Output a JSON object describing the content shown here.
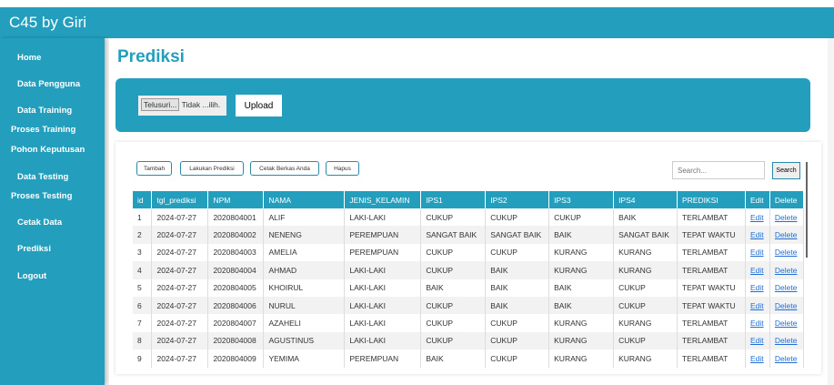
{
  "app_title": "C45 by Giri",
  "sidebar": {
    "items": [
      {
        "label": "Home"
      },
      {
        "label": "Data Pengguna"
      },
      {
        "label": "Data Training"
      },
      {
        "label": "Proses Training"
      },
      {
        "label": "Pohon Keputusan"
      },
      {
        "label": "Data Testing"
      },
      {
        "label": "Proses Testing"
      },
      {
        "label": "Cetak Data"
      },
      {
        "label": "Prediksi"
      },
      {
        "label": "Logout"
      }
    ]
  },
  "page_title": "Prediksi",
  "upload": {
    "browse": "Telusuri...",
    "file_status": "Tidak ...ilih.",
    "upload_label": "Upload"
  },
  "toolbar": {
    "tambah": "Tambah",
    "lakukan": "Lakukan Prediksi",
    "cetak": "Cetak Berkas Anda",
    "hapus": "Hapus",
    "search_placeholder": "Search...",
    "search_label": "Search"
  },
  "table": {
    "headers": [
      "id",
      "tgl_prediksi",
      "NPM",
      "NAMA",
      "JENIS_KELAMIN",
      "IPS1",
      "IPS2",
      "IPS3",
      "IPS4",
      "PREDIKSI",
      "Edit",
      "Delete"
    ],
    "rows": [
      [
        "1",
        "2024-07-27",
        "2020804001",
        "ALIF",
        "LAKI-LAKI",
        "CUKUP",
        "CUKUP",
        "CUKUP",
        "BAIK",
        "TERLAMBAT",
        "Edit",
        "Delete"
      ],
      [
        "2",
        "2024-07-27",
        "2020804002",
        "NENENG",
        "PEREMPUAN",
        "SANGAT BAIK",
        "SANGAT BAIK",
        "BAIK",
        "SANGAT BAIK",
        "TEPAT WAKTU",
        "Edit",
        "Delete"
      ],
      [
        "3",
        "2024-07-27",
        "2020804003",
        "AMELIA",
        "PEREMPUAN",
        "CUKUP",
        "CUKUP",
        "KURANG",
        "KURANG",
        "TERLAMBAT",
        "Edit",
        "Delete"
      ],
      [
        "4",
        "2024-07-27",
        "2020804004",
        "AHMAD",
        "LAKI-LAKI",
        "CUKUP",
        "BAIK",
        "KURANG",
        "KURANG",
        "TERLAMBAT",
        "Edit",
        "Delete"
      ],
      [
        "5",
        "2024-07-27",
        "2020804005",
        "KHOIRUL",
        "LAKI-LAKI",
        "BAIK",
        "BAIK",
        "BAIK",
        "CUKUP",
        "TEPAT WAKTU",
        "Edit",
        "Delete"
      ],
      [
        "6",
        "2024-07-27",
        "2020804006",
        "NURUL",
        "LAKI-LAKI",
        "CUKUP",
        "BAIK",
        "BAIK",
        "CUKUP",
        "TEPAT WAKTU",
        "Edit",
        "Delete"
      ],
      [
        "7",
        "2024-07-27",
        "2020804007",
        "AZAHELI",
        "LAKI-LAKI",
        "CUKUP",
        "CUKUP",
        "KURANG",
        "KURANG",
        "TERLAMBAT",
        "Edit",
        "Delete"
      ],
      [
        "8",
        "2024-07-27",
        "2020804008",
        "AGUSTINUS",
        "LAKI-LAKI",
        "CUKUP",
        "CUKUP",
        "KURANG",
        "CUKUP",
        "TERLAMBAT",
        "Edit",
        "Delete"
      ],
      [
        "9",
        "2024-07-27",
        "2020804009",
        "YEMIMA",
        "PEREMPUAN",
        "BAIK",
        "CUKUP",
        "KURANG",
        "KURANG",
        "TERLAMBAT",
        "Edit",
        "Delete"
      ]
    ]
  }
}
